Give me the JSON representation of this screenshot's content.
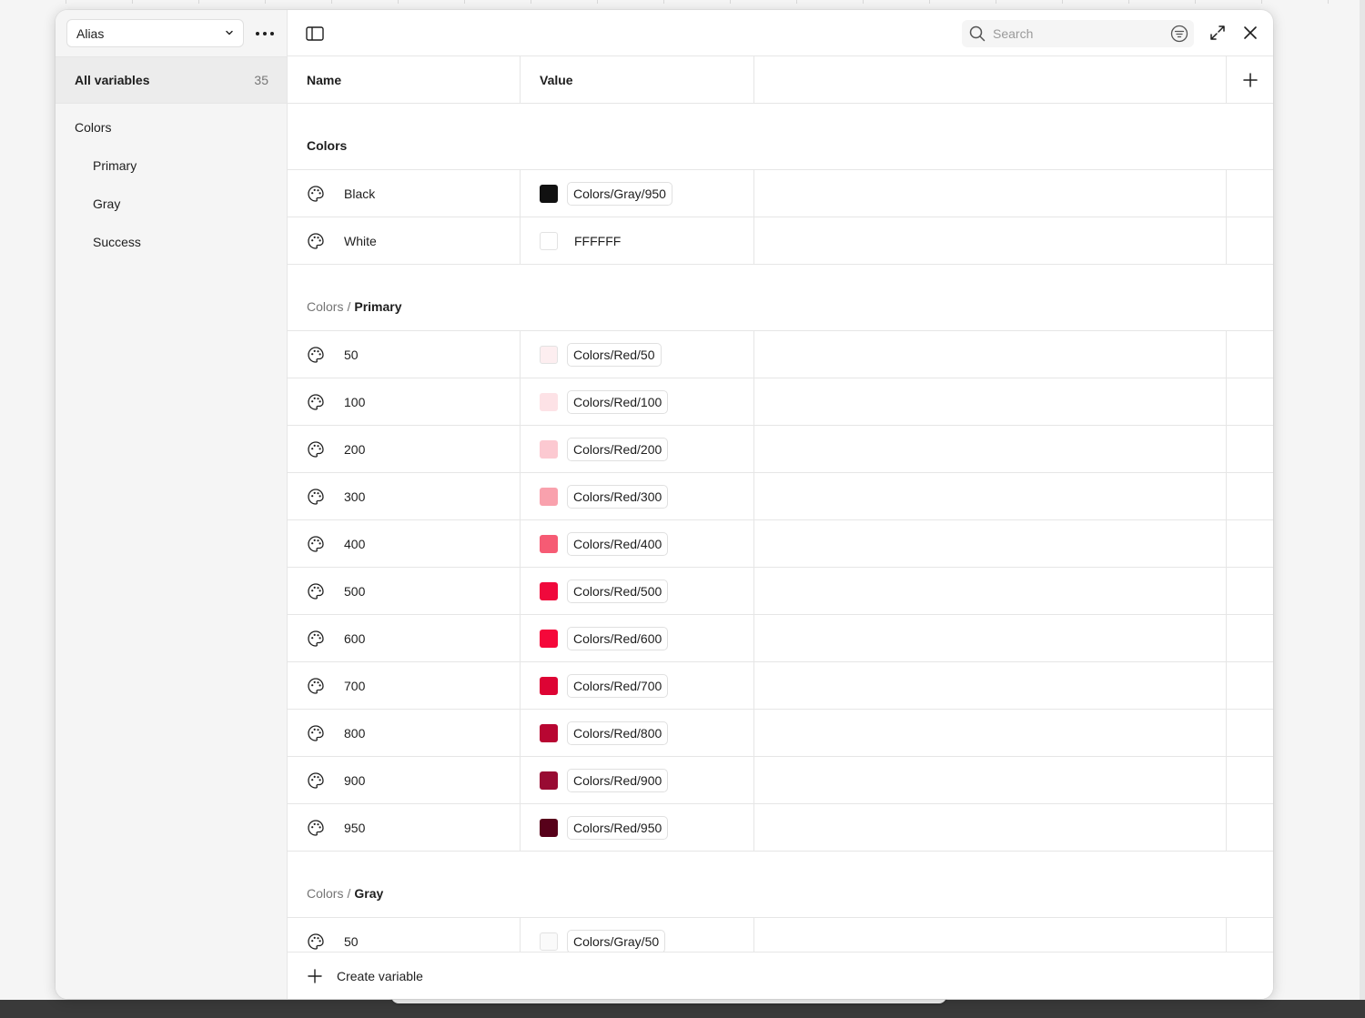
{
  "sidebar": {
    "mode": "Alias",
    "all_variables": {
      "label": "All variables",
      "count": "35"
    },
    "groups": [
      {
        "label": "Colors",
        "level": 0
      },
      {
        "label": "Primary",
        "level": 1
      },
      {
        "label": "Gray",
        "level": 1
      },
      {
        "label": "Success",
        "level": 1
      }
    ]
  },
  "toolbar": {
    "search_placeholder": "Search"
  },
  "table": {
    "columns": {
      "name": "Name",
      "value": "Value"
    },
    "sections": {
      "colors": {
        "title": "Colors",
        "rows": [
          {
            "name": "Black",
            "swatch": "#111111",
            "alias": "Colors/Gray/950"
          },
          {
            "name": "White",
            "swatch": "#FFFFFF",
            "raw": "FFFFFF"
          }
        ]
      },
      "primary": {
        "parent": "Colors",
        "separator": "/",
        "title": "Primary",
        "rows": [
          {
            "name": "50",
            "swatch": "#FDEEF0",
            "alias": "Colors/Red/50"
          },
          {
            "name": "100",
            "swatch": "#FDE2E6",
            "alias": "Colors/Red/100"
          },
          {
            "name": "200",
            "swatch": "#FCC9D1",
            "alias": "Colors/Red/200"
          },
          {
            "name": "300",
            "swatch": "#F9A1AD",
            "alias": "Colors/Red/300"
          },
          {
            "name": "400",
            "swatch": "#F65B74",
            "alias": "Colors/Red/400"
          },
          {
            "name": "500",
            "swatch": "#F0093C",
            "alias": "Colors/Red/500"
          },
          {
            "name": "600",
            "swatch": "#F5083A",
            "alias": "Colors/Red/600"
          },
          {
            "name": "700",
            "swatch": "#DD0434",
            "alias": "Colors/Red/700"
          },
          {
            "name": "800",
            "swatch": "#B80632",
            "alias": "Colors/Red/800"
          },
          {
            "name": "900",
            "swatch": "#980B33",
            "alias": "Colors/Red/900"
          },
          {
            "name": "950",
            "swatch": "#57011A",
            "alias": "Colors/Red/950"
          }
        ]
      },
      "gray": {
        "parent": "Colors",
        "separator": "/",
        "title": "Gray",
        "rows": [
          {
            "name": "50",
            "swatch": "#FAFAFA",
            "alias": "Colors/Gray/50"
          }
        ]
      }
    }
  },
  "footer": {
    "create_label": "Create variable"
  },
  "colors": {
    "border": "#E6E6E6",
    "sidebar_bg": "#F5F5F5",
    "selected_bg": "#ECECEC"
  },
  "icons": [
    "chevron-down-icon",
    "more-icon",
    "sidebar-toggle-icon",
    "search-icon",
    "filter-icon",
    "expand-icon",
    "close-icon",
    "plus-icon",
    "palette-icon"
  ]
}
